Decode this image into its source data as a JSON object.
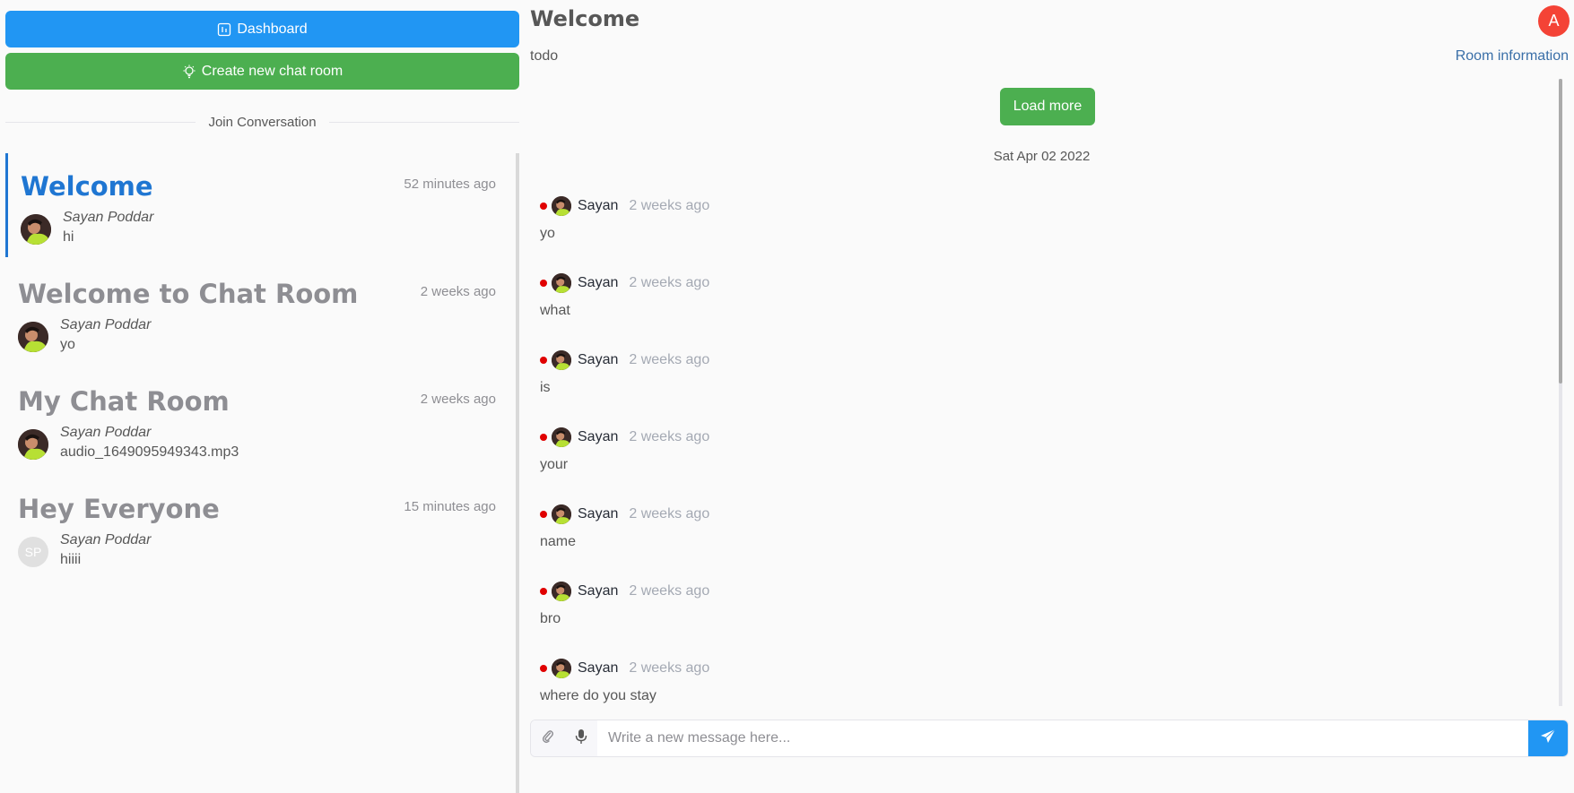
{
  "sidebar": {
    "dashboard_label": "Dashboard",
    "create_label": "Create new chat room",
    "divider_label": "Join Conversation",
    "rooms": [
      {
        "title": "Welcome",
        "time": "52 minutes ago",
        "author": "Sayan Poddar",
        "last_message": "hi",
        "avatar": "photo",
        "active": true
      },
      {
        "title": "Welcome to Chat Room",
        "time": "2 weeks ago",
        "author": "Sayan Poddar",
        "last_message": "yo",
        "avatar": "photo",
        "active": false
      },
      {
        "title": "My Chat Room",
        "time": "2 weeks ago",
        "author": "Sayan Poddar",
        "last_message": "audio_1649095949343.mp3",
        "avatar": "photo",
        "active": false
      },
      {
        "title": "Hey Everyone",
        "time": "15 minutes ago",
        "author": "Sayan Poddar",
        "last_message": "hiiii",
        "avatar": "initials",
        "initials": "SP",
        "active": false
      }
    ]
  },
  "header": {
    "title": "Welcome",
    "description": "todo",
    "room_info_label": "Room information",
    "user_initial": "A"
  },
  "chat": {
    "load_more_label": "Load more",
    "date_separator": "Sat Apr 02 2022",
    "messages": [
      {
        "author": "Sayan",
        "time": "2 weeks ago",
        "text": "yo"
      },
      {
        "author": "Sayan",
        "time": "2 weeks ago",
        "text": "what"
      },
      {
        "author": "Sayan",
        "time": "2 weeks ago",
        "text": "is"
      },
      {
        "author": "Sayan",
        "time": "2 weeks ago",
        "text": "your"
      },
      {
        "author": "Sayan",
        "time": "2 weeks ago",
        "text": "name"
      },
      {
        "author": "Sayan",
        "time": "2 weeks ago",
        "text": "bro"
      },
      {
        "author": "Sayan",
        "time": "2 weeks ago",
        "text": "where do you stay"
      }
    ]
  },
  "composer": {
    "placeholder": "Write a new message here...",
    "attach_icon": "paperclip-icon",
    "mic_icon": "microphone-icon",
    "send_icon": "send-icon"
  },
  "colors": {
    "primary_blue": "#2196f3",
    "success_green": "#4caf50",
    "active_title": "#1f76d2",
    "avatar_red": "#f44336",
    "presence_red": "#e00000"
  }
}
